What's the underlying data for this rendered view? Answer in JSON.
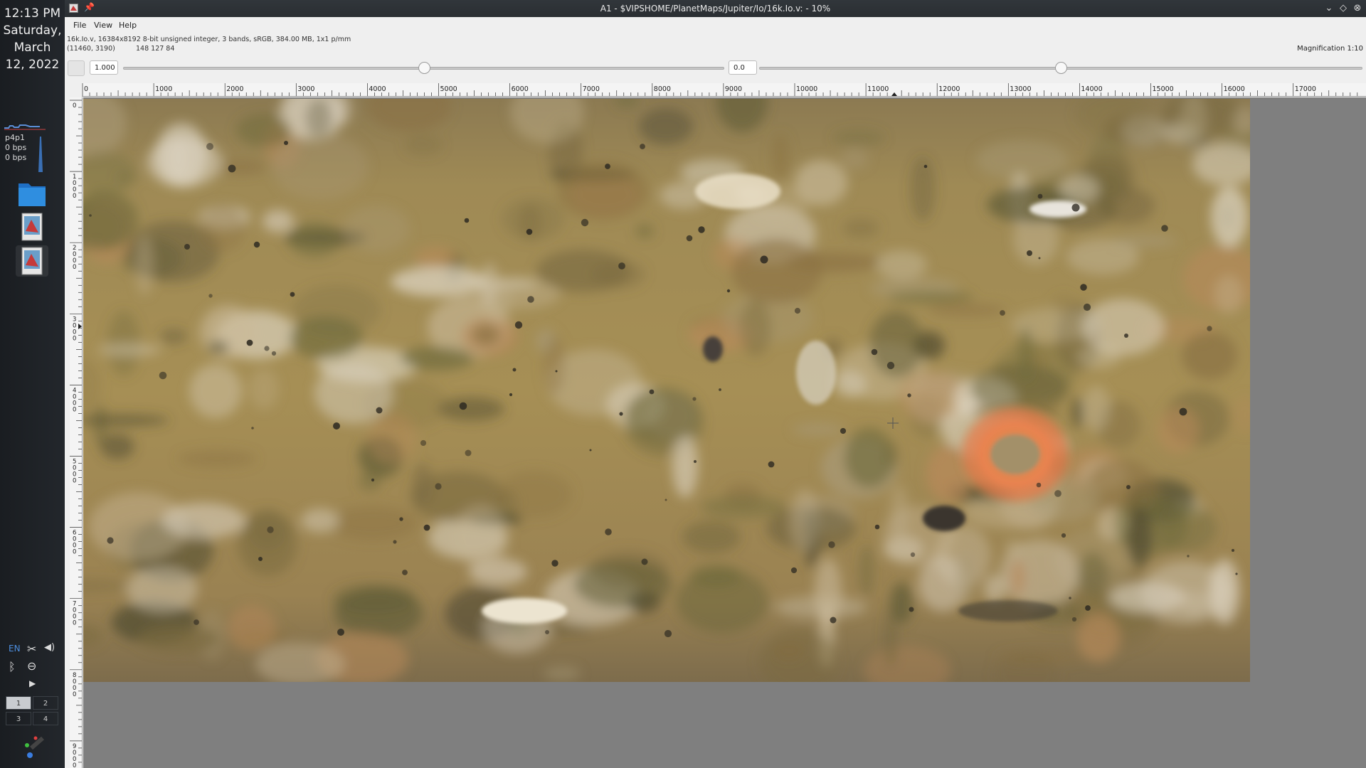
{
  "dock": {
    "clock": {
      "time": "12:13 PM",
      "day": "Saturday,",
      "month": "March",
      "date": "12, 2022"
    },
    "network": {
      "interface": "p4p1",
      "down": "0 bps",
      "up": "0 bps"
    },
    "apps": [
      "folder-icon",
      "vips-icon",
      "vips-icon"
    ],
    "tray": {
      "language": "EN"
    },
    "pager": [
      "1",
      "2",
      "3",
      "4"
    ]
  },
  "window": {
    "title": "A1 - $VIPSHOME/PlanetMaps/Jupiter/Io/16k.Io.v: - 10%",
    "menu": [
      "File",
      "View",
      "Help"
    ],
    "info": {
      "header": "16k.Io.v, 16384x8192 8-bit unsigned integer, 3 bands, sRGB, 384.00 MB, 1x1 p/mm",
      "coords": "(11460,  3190)",
      "pixel": "148  127  84"
    },
    "magnification": "Magnification 1:10",
    "scale_value": "1.000",
    "offset_value": "0.0",
    "scale_slider_fraction": 0.5,
    "offset_slider_fraction": 0.5,
    "ruler_h": [
      "0",
      "1000",
      "2000",
      "3000",
      "4000",
      "5000",
      "6000",
      "7000",
      "8000",
      "9000",
      "10000",
      "11000",
      "12000",
      "13000",
      "14000",
      "15000",
      "16000",
      "17000"
    ],
    "ruler_v": [
      "0",
      "1000",
      "2000",
      "3000",
      "4000",
      "5000",
      "6000",
      "7000",
      "8000",
      "9000"
    ]
  },
  "colors": {
    "titlebar": "#2d3136",
    "dock": "#1f2226",
    "canvas_bg": "#7f7f7f",
    "io_base": "#a08a4e",
    "io_hotspot": "#e07a4a"
  }
}
